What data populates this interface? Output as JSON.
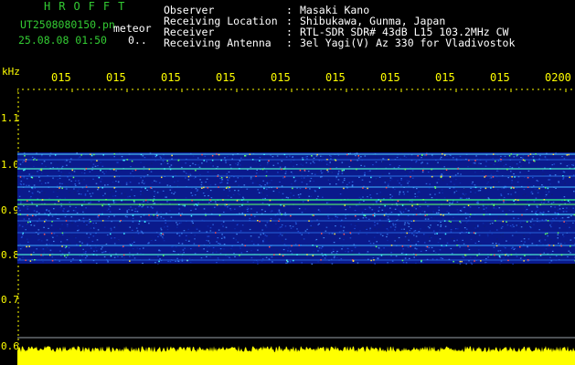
{
  "header": {
    "logo": "HROFFT",
    "file_name": "UT2508080150.pn",
    "file_tag": "meteor",
    "datetime": "25.08.08 01:50",
    "extra": "0.."
  },
  "metadata": [
    {
      "label": "Observer",
      "value": "Masaki Kano"
    },
    {
      "label": "Receiving Location",
      "value": "Shibukawa, Gunma, Japan"
    },
    {
      "label": "Receiver",
      "value": "RTL-SDR SDR# 43dB L15 103.2MHz CW"
    },
    {
      "label": "Receiving Antenna",
      "value": "3el Yagi(V) Az 330 for Vladivostok"
    }
  ],
  "separator": ":",
  "axis": {
    "y_unit": "kHz",
    "x_ticks": [
      "015",
      "015",
      "015",
      "015",
      "015",
      "015",
      "015",
      "015",
      "015",
      "0200"
    ],
    "y_ticks": [
      "1.1",
      "1.0",
      "0.9",
      "0.8",
      "0.7",
      "0.6"
    ]
  },
  "colors": {
    "background": "#000000",
    "logo": "#33cc33",
    "text": "#ffffff",
    "axis_text": "#ffff00",
    "signal_strip": "#ffff00",
    "noise_base": "#0a1a8c"
  }
}
